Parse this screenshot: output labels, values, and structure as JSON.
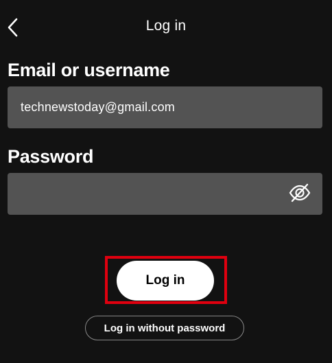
{
  "header": {
    "title": "Log in",
    "back_icon": "chevron-left-icon"
  },
  "email": {
    "label": "Email or username",
    "value": "technewstoday@gmail.com"
  },
  "password": {
    "label": "Password",
    "value": "",
    "toggle_icon": "eye-off-icon"
  },
  "actions": {
    "login_label": "Log in",
    "passwordless_label": "Log in without password"
  },
  "colors": {
    "background": "#121212",
    "field": "#535353",
    "primary_button": "#ffffff",
    "highlight": "#e0000f"
  }
}
